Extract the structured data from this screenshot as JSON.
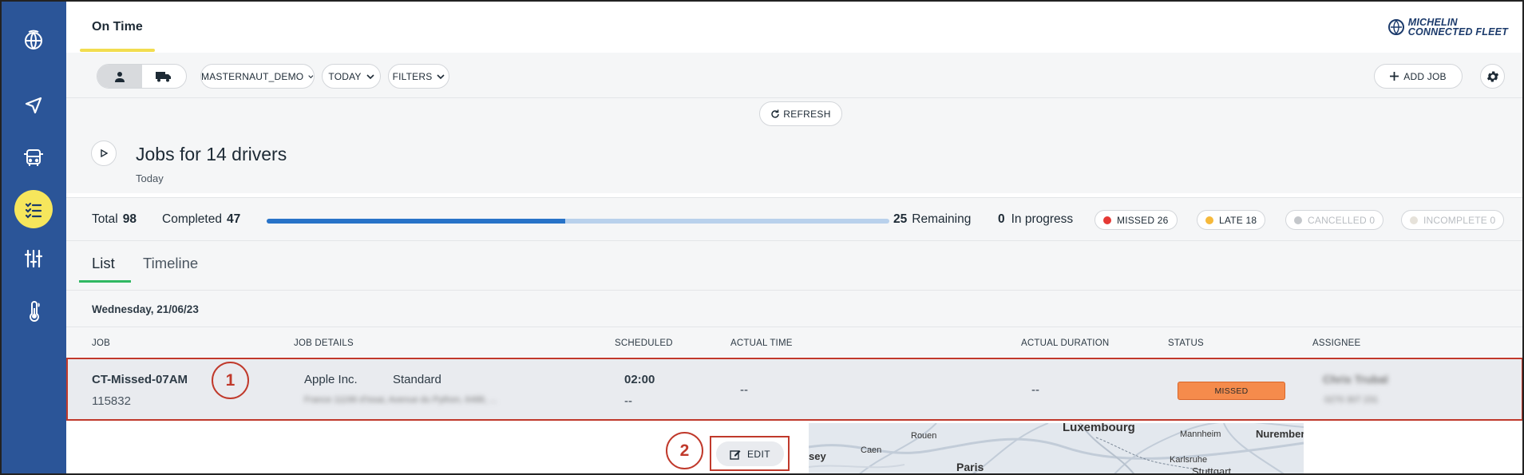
{
  "header": {
    "tab_title": "On Time",
    "brand_line1": "MICHELIN",
    "brand_line2": "CONNECTED FLEET"
  },
  "sidebar": {
    "items": [
      {
        "icon": "fleet-logo-icon",
        "active": false
      },
      {
        "icon": "navigation-icon",
        "active": false
      },
      {
        "icon": "vehicle-icon",
        "active": false
      },
      {
        "icon": "task-list-icon",
        "active": true
      },
      {
        "icon": "sliders-icon",
        "active": false
      },
      {
        "icon": "temperature-icon",
        "active": false
      }
    ]
  },
  "toolbar": {
    "account": "MASTERNAUT_DEMO",
    "period": "TODAY",
    "filters": "FILTERS",
    "add_job": "ADD JOB",
    "refresh": "REFRESH"
  },
  "jobs": {
    "title": "Jobs for 14 drivers",
    "subtitle": "Today"
  },
  "stats": {
    "total_label": "Total",
    "total": "98",
    "completed_label": "Completed",
    "completed": "47",
    "progress_fraction": 0.48,
    "remaining": "25",
    "remaining_label": "Remaining",
    "in_progress": "0",
    "in_progress_label": "In progress",
    "badges": {
      "missed": "MISSED 26",
      "late": "LATE 18",
      "cancelled": "CANCELLED 0",
      "incomplete": "INCOMPLETE 0"
    },
    "colors": {
      "missed": "#e53935",
      "late": "#f6b93b",
      "cancelled": "#c4c7cb",
      "incomplete": "#e6e2da"
    }
  },
  "tabs": {
    "list": "List",
    "timeline": "Timeline"
  },
  "date_label": "Wednesday, 21/06/23",
  "table": {
    "headers": {
      "job": "JOB",
      "job_details": "JOB DETAILS",
      "scheduled": "SCHEDULED",
      "actual_time": "ACTUAL TIME",
      "actual_duration": "ACTUAL DURATION",
      "status": "STATUS",
      "assignee": "ASSIGNEE"
    },
    "row": {
      "job_name": "CT-Missed-07AM",
      "job_id": "115832",
      "customer": "Apple Inc.",
      "job_type": "Standard",
      "address": "France 11196 d'Issai, Avenue du Python, 6488, ...",
      "scheduled_time": "02:00",
      "scheduled_sub": "--",
      "actual_time": "--",
      "actual_duration": "--",
      "status": "MISSED",
      "assignee_name": "Chris Trubal",
      "assignee_phone": "0270 307 231"
    }
  },
  "markers": {
    "one": "1",
    "two": "2"
  },
  "edit_label": "EDIT",
  "map": {
    "labels": [
      "Luxembourg",
      "Nuremberg",
      "Mannheim",
      "Rouen",
      "Caen",
      "Karlsruhe",
      "Paris",
      "Stuttgart",
      "sey"
    ]
  }
}
